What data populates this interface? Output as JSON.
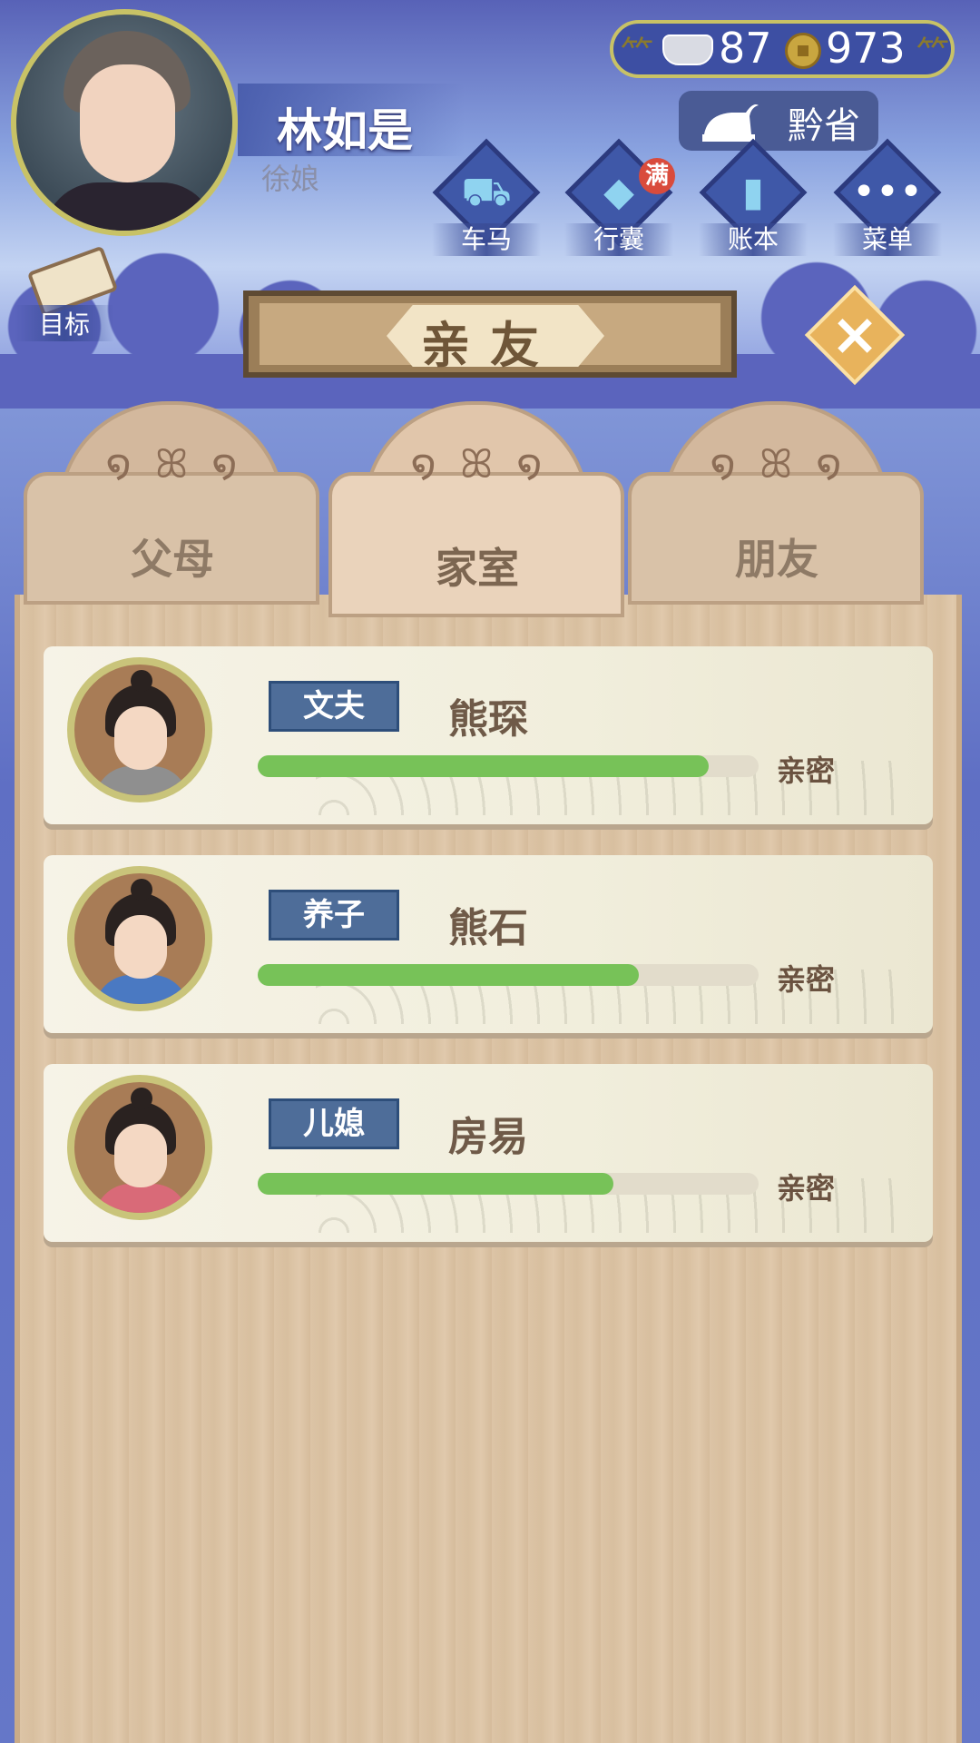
{
  "player": {
    "name": "林如是",
    "title": "徐娘"
  },
  "currency": {
    "silver": "87",
    "copper": "973"
  },
  "location": "黔省",
  "menu": [
    {
      "label": "车马",
      "icon": "carriage-icon",
      "badge": ""
    },
    {
      "label": "行囊",
      "icon": "bag-icon",
      "badge": "满"
    },
    {
      "label": "账本",
      "icon": "ledger-icon",
      "badge": ""
    },
    {
      "label": "菜单",
      "icon": "more-icon",
      "badge": ""
    }
  ],
  "goal_label": "目标",
  "panel_title": "亲友",
  "tabs": [
    {
      "label": "父母",
      "active": false
    },
    {
      "label": "家室",
      "active": true
    },
    {
      "label": "朋友",
      "active": false
    }
  ],
  "relatives": [
    {
      "relation": "文夫",
      "name": "熊琛",
      "intimacy_fraction": 0.9,
      "intimacy_label": "亲密",
      "robe": "#8f8f8f"
    },
    {
      "relation": "养子",
      "name": "熊石",
      "intimacy_fraction": 0.76,
      "intimacy_label": "亲密",
      "robe": "#4a79c2"
    },
    {
      "relation": "儿媳",
      "name": "房易",
      "intimacy_fraction": 0.71,
      "intimacy_label": "亲密",
      "robe": "#d96a78"
    }
  ],
  "colors": {
    "accent_gold": "#c8c266",
    "bar_green": "#77c258",
    "tag_blue": "#4e6d99",
    "badge_red": "#d94b3c"
  }
}
